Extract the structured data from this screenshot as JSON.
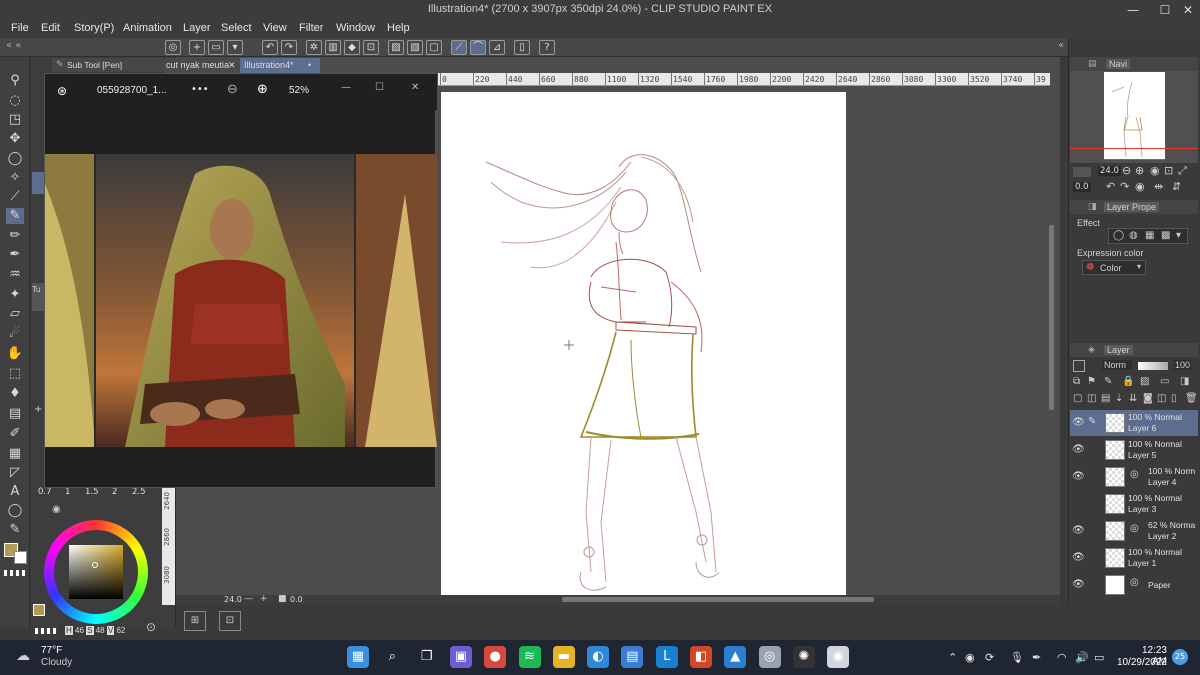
{
  "window": {
    "title": "Illustration4* (2700 x 3907px 350dpi 24.0%)  - CLIP STUDIO PAINT EX",
    "minimize": "—",
    "maximize": "☐",
    "close": "✕"
  },
  "menu": [
    "File",
    "Edit",
    "Story(P)",
    "Animation",
    "Layer",
    "Select",
    "View",
    "Filter",
    "Window",
    "Help"
  ],
  "subtool": {
    "header": "Sub Tool [Pen]",
    "tab_partial": "Tu",
    "brush_sizes": [
      "0.7",
      "1",
      "1.5",
      "2",
      "2.5"
    ],
    "color_readout": {
      "h_label": "H",
      "h": "46",
      "s_label": "S",
      "s": "48",
      "v_label": "V",
      "v": "62"
    }
  },
  "tabs": [
    {
      "label": "cut nyak meutia",
      "close": "✕"
    },
    {
      "label": "Illustration4*",
      "close": "•"
    }
  ],
  "ruler": {
    "ticks": [
      "0",
      "220",
      "440",
      "660",
      "880",
      "1100",
      "1320",
      "1540",
      "1760",
      "1980",
      "2200",
      "2420",
      "2640",
      "2860",
      "3080",
      "3300",
      "3520",
      "3740",
      "39"
    ],
    "side_ticks": [
      "2640",
      "2860",
      "3080"
    ]
  },
  "viewer": {
    "filename": "055928700_1...",
    "more": "•••",
    "zoom_out": "⊖",
    "zoom_in": "⊕",
    "zoom": "52%",
    "minimize": "—",
    "maximize": "☐",
    "close": "✕"
  },
  "canvas_bottom": {
    "zoom": "24.0",
    "rotation": "0.0"
  },
  "navigator": {
    "title": "Navi",
    "zoom": "24.0",
    "rotation": "0.0"
  },
  "layer_property": {
    "title": "Layer Prope",
    "effect_label": "Effect",
    "expression_label": "Expression color",
    "expression_value": "Color"
  },
  "layers_panel": {
    "title": "Layer",
    "blend_mode": "Norm",
    "opacity": "100",
    "layers": [
      {
        "mode": "100 % Normal",
        "name": "Layer 6",
        "selected": true,
        "visible": true,
        "icon": "pencil-icon"
      },
      {
        "mode": "100 % Normal",
        "name": "Layer 5",
        "selected": false,
        "visible": true,
        "icon": ""
      },
      {
        "mode": "100 % Norm",
        "name": "Layer 4",
        "selected": false,
        "visible": true,
        "icon": "folder-icon"
      },
      {
        "mode": "100 % Normal",
        "name": "Layer 3",
        "selected": false,
        "visible": false,
        "icon": ""
      },
      {
        "mode": "62 % Norma",
        "name": "Layer 2",
        "selected": false,
        "visible": true,
        "icon": "folder-icon"
      },
      {
        "mode": "100 % Normal",
        "name": "Layer 1",
        "selected": false,
        "visible": true,
        "icon": ""
      },
      {
        "mode": "",
        "name": "Paper",
        "selected": false,
        "visible": true,
        "icon": "paper-icon"
      }
    ]
  },
  "taskbar": {
    "weather_temp": "77°F",
    "weather_desc": "Cloudy",
    "time": "12:23 AM",
    "date": "10/29/2022",
    "notification_count": "25",
    "pinned": [
      {
        "name": "start-button",
        "glyph": "▦",
        "color": "#3a8fe0"
      },
      {
        "name": "search-button",
        "glyph": "⌕",
        "color": "#1f2632"
      },
      {
        "name": "task-view-button",
        "glyph": "❐",
        "color": "#1f2632"
      },
      {
        "name": "chat-app",
        "glyph": "▣",
        "color": "#6b5fd3"
      },
      {
        "name": "chrome-app",
        "glyph": "●",
        "color": "#d64a3a"
      },
      {
        "name": "spotify-app",
        "glyph": "≋",
        "color": "#1db954"
      },
      {
        "name": "file-explorer-app",
        "glyph": "▬",
        "color": "#e6b422"
      },
      {
        "name": "edge-app",
        "glyph": "◐",
        "color": "#2e8ad8"
      },
      {
        "name": "store-app",
        "glyph": "▤",
        "color": "#3a7bd5"
      },
      {
        "name": "l-app",
        "glyph": "L",
        "color": "#1a7fd0"
      },
      {
        "name": "office-app",
        "glyph": "◧",
        "color": "#d24726"
      },
      {
        "name": "photos-app",
        "glyph": "▲",
        "color": "#2a7fd3"
      },
      {
        "name": "clip-studio-launcher-app",
        "glyph": "◎",
        "color": "#9aa3ad"
      },
      {
        "name": "davinci-app",
        "glyph": "✺",
        "color": "#333"
      },
      {
        "name": "clip-studio-paint-app",
        "glyph": "◉",
        "color": "#cfd6dc"
      }
    ]
  },
  "colors": {
    "accent": "#5d6d8f",
    "sketch_red": "#b0625a",
    "sketch_olive": "#a39030",
    "main_color": "#b39a55"
  }
}
